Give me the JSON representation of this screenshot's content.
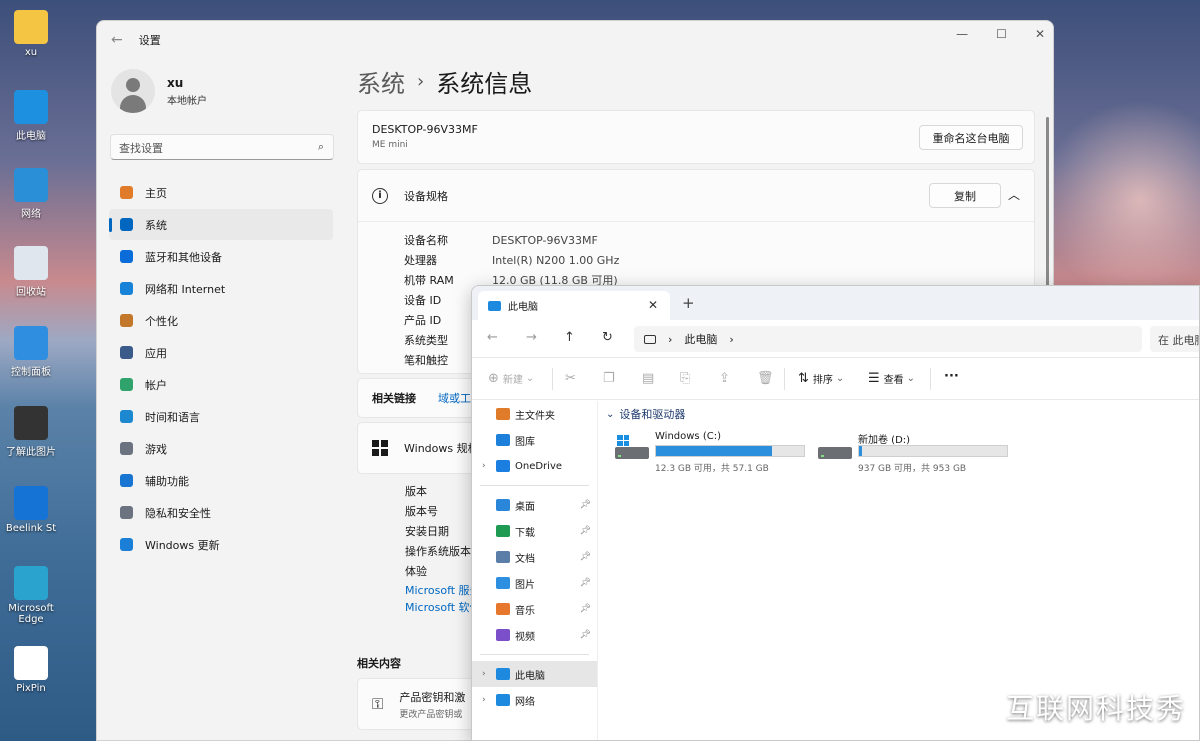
{
  "desktop": {
    "icons": [
      {
        "label": "xu",
        "name": "folder-icon",
        "color": "#f4c542"
      },
      {
        "label": "此电脑",
        "name": "computer-icon",
        "color": "#1e90e0"
      },
      {
        "label": "网络",
        "name": "network-icon",
        "color": "#2a8fd6"
      },
      {
        "label": "回收站",
        "name": "recycle-bin-icon",
        "color": "#dfe6ee"
      },
      {
        "label": "控制面板",
        "name": "control-panel-icon",
        "color": "#2f8ee0"
      },
      {
        "label": "了解此图片",
        "name": "learn-picture-icon",
        "color": "#333333"
      },
      {
        "label": "Beelink St",
        "name": "beelink-icon",
        "color": "#1673d6"
      },
      {
        "label": "Microsoft Edge",
        "name": "edge-icon",
        "color": "#2aa3cf"
      },
      {
        "label": "PixPin",
        "name": "pixpin-icon",
        "color": "#ffffff"
      }
    ],
    "watermark": "互联网科技秀"
  },
  "settings": {
    "title": "设置",
    "user": {
      "name": "xu",
      "account_type": "本地帐户"
    },
    "search_placeholder": "查找设置",
    "nav": [
      {
        "label": "主页",
        "icon": "home-icon",
        "color": "#e07b2a"
      },
      {
        "label": "系统",
        "icon": "system-icon",
        "color": "#0067c0",
        "active": true
      },
      {
        "label": "蓝牙和其他设备",
        "icon": "bluetooth-icon",
        "color": "#0a6cd8"
      },
      {
        "label": "网络和 Internet",
        "icon": "wifi-icon",
        "color": "#1683d8"
      },
      {
        "label": "个性化",
        "icon": "brush-icon",
        "color": "#c2772b"
      },
      {
        "label": "应用",
        "icon": "apps-icon",
        "color": "#3a5a8a"
      },
      {
        "label": "帐户",
        "icon": "account-icon",
        "color": "#2fa36b"
      },
      {
        "label": "时间和语言",
        "icon": "globe-clock-icon",
        "color": "#1b88cf"
      },
      {
        "label": "游戏",
        "icon": "gamepad-icon",
        "color": "#6b7280"
      },
      {
        "label": "辅助功能",
        "icon": "accessibility-icon",
        "color": "#1875d1"
      },
      {
        "label": "隐私和安全性",
        "icon": "shield-icon",
        "color": "#6b7280"
      },
      {
        "label": "Windows 更新",
        "icon": "update-icon",
        "color": "#1b7fd8"
      }
    ],
    "breadcrumb": {
      "parent": "系统",
      "current": "系统信息"
    },
    "pc": {
      "name": "DESKTOP-96V33MF",
      "model": "ME mini",
      "rename_button": "重命名这台电脑"
    },
    "device_specs": {
      "title": "设备规格",
      "copy_button": "复制",
      "rows": [
        {
          "key": "设备名称",
          "value": "DESKTOP-96V33MF"
        },
        {
          "key": "处理器",
          "value": "Intel(R) N200   1.00 GHz"
        },
        {
          "key": "机带 RAM",
          "value": "12.0 GB (11.8 GB 可用)"
        },
        {
          "key": "设备 ID",
          "value": ""
        },
        {
          "key": "产品 ID",
          "value": ""
        },
        {
          "key": "系统类型",
          "value": ""
        },
        {
          "key": "笔和触控",
          "value": ""
        }
      ]
    },
    "related_links": {
      "label": "相关链接",
      "link": "域或工作"
    },
    "windows_specs": {
      "title": "Windows 规格",
      "rows": [
        "版本",
        "版本号",
        "安装日期",
        "操作系统版本",
        "体验"
      ],
      "links": [
        "Microsoft 服务",
        "Microsoft 软件"
      ]
    },
    "related_content": {
      "title": "相关内容",
      "item_title": "产品密钥和激",
      "item_sub": "更改产品密钥或"
    }
  },
  "explorer": {
    "tab_title": "此电脑",
    "new_tab": "+",
    "address": "此电脑",
    "search_placeholder": "在 此电脑",
    "toolbar": {
      "new": "新建",
      "sort": "排序",
      "view": "查看",
      "more": "···"
    },
    "sidebar": [
      {
        "label": "主文件夹",
        "icon": "home-icon",
        "color": "#e07b2a"
      },
      {
        "label": "图库",
        "icon": "gallery-icon",
        "color": "#1c7fd9"
      },
      {
        "label": "OneDrive",
        "icon": "onedrive-icon",
        "color": "#1a7fe0",
        "expandable": true
      },
      {
        "sep": true
      },
      {
        "label": "桌面",
        "icon": "desktop-icon",
        "color": "#2a86d8",
        "pinned": true
      },
      {
        "label": "下载",
        "icon": "download-icon",
        "color": "#1e9a52",
        "pinned": true
      },
      {
        "label": "文档",
        "icon": "document-icon",
        "color": "#5a7ea8",
        "pinned": true
      },
      {
        "label": "图片",
        "icon": "pictures-icon",
        "color": "#2d8fdf",
        "pinned": true
      },
      {
        "label": "音乐",
        "icon": "music-icon",
        "color": "#e8772e",
        "pinned": true
      },
      {
        "label": "视频",
        "icon": "video-icon",
        "color": "#7a4fc9",
        "pinned": true
      },
      {
        "sep": true
      },
      {
        "label": "此电脑",
        "icon": "computer-icon",
        "color": "#1d8ae0",
        "expandable": true,
        "active": true
      },
      {
        "label": "网络",
        "icon": "network-icon",
        "color": "#1d8ae0",
        "expandable": true
      }
    ],
    "group_title": "设备和驱动器",
    "drives": [
      {
        "name": "Windows (C:)",
        "size": "12.3 GB 可用，共 57.1 GB",
        "used_fraction": 0.785,
        "system": true
      },
      {
        "name": "新加卷 (D:)",
        "size": "937 GB 可用，共 953 GB",
        "used_fraction": 0.017,
        "system": false
      }
    ],
    "accent": "#2b8fde"
  }
}
